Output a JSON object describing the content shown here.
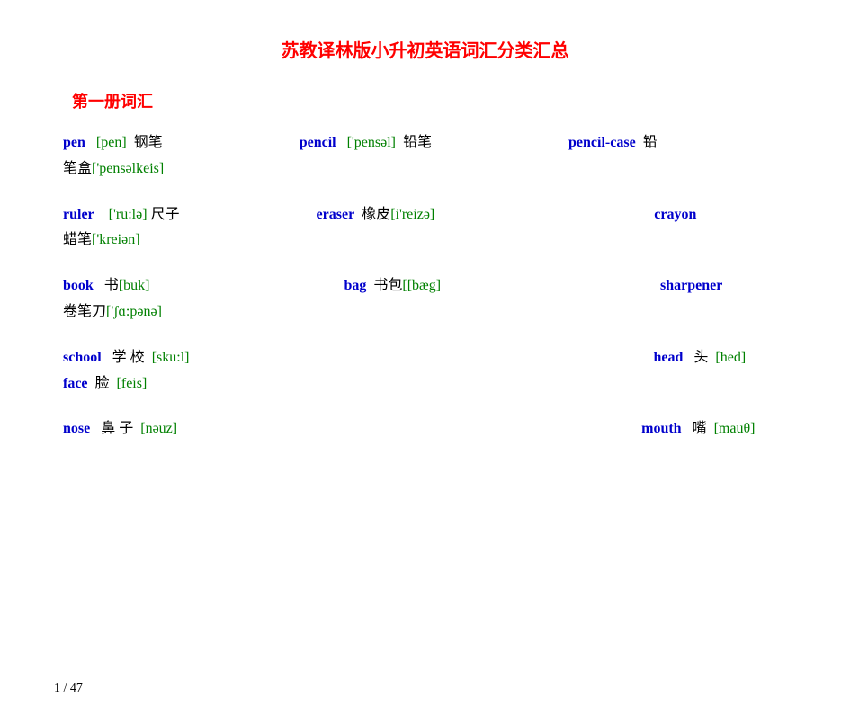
{
  "page": {
    "title": "苏教译林版小升初英语词汇分类汇总",
    "section1_title": "第一册词汇",
    "vocab_blocks": [
      {
        "id": "block1",
        "entries": [
          {
            "word": "pen",
            "phonetic": "[pen]",
            "zh": "钢笔",
            "col": 1
          },
          {
            "word": "pencil",
            "phonetic": "['pensəl]",
            "zh": "铅笔",
            "col": 2
          },
          {
            "word": "pencil-case",
            "phonetic": "",
            "zh": "铅笔盒['pensəlkeis]",
            "col": 3
          }
        ]
      },
      {
        "id": "block2",
        "entries": [
          {
            "word": "ruler",
            "phonetic": "['ru:lə]",
            "zh": "尺子",
            "col": 1
          },
          {
            "word": "eraser",
            "phonetic": "橡皮[i'reizə]",
            "zh": "",
            "col": 2
          },
          {
            "word": "crayon",
            "phonetic": "",
            "zh": "蜡笔['kreiən]",
            "col": 3
          }
        ]
      },
      {
        "id": "block3",
        "entries": [
          {
            "word": "book",
            "phonetic": "",
            "zh": "书[buk]",
            "col": 1
          },
          {
            "word": "bag",
            "phonetic": "",
            "zh": "书包[[bæg]",
            "col": 2
          },
          {
            "word": "sharpener",
            "phonetic": "",
            "zh": "卷笔刀['ʃɑ:pənə]",
            "col": 3
          }
        ]
      },
      {
        "id": "block4",
        "entries": [
          {
            "word": "school",
            "phonetic": "",
            "zh": "学 校 [sku:l]",
            "col": 1
          },
          {
            "word": "head",
            "phonetic": "",
            "zh": "头 [hed]",
            "col": 2
          },
          {
            "word": "face",
            "phonetic": "",
            "zh": "脸 [feis]",
            "col": 3
          }
        ]
      },
      {
        "id": "block5",
        "entries": [
          {
            "word": "nose",
            "phonetic": "",
            "zh": "鼻 子 [nəuz]",
            "col": 1
          },
          {
            "word": "mouth",
            "phonetic": "",
            "zh": "嘴 [mauθ]",
            "col": 2
          }
        ]
      }
    ],
    "page_number": "1 / 47"
  }
}
